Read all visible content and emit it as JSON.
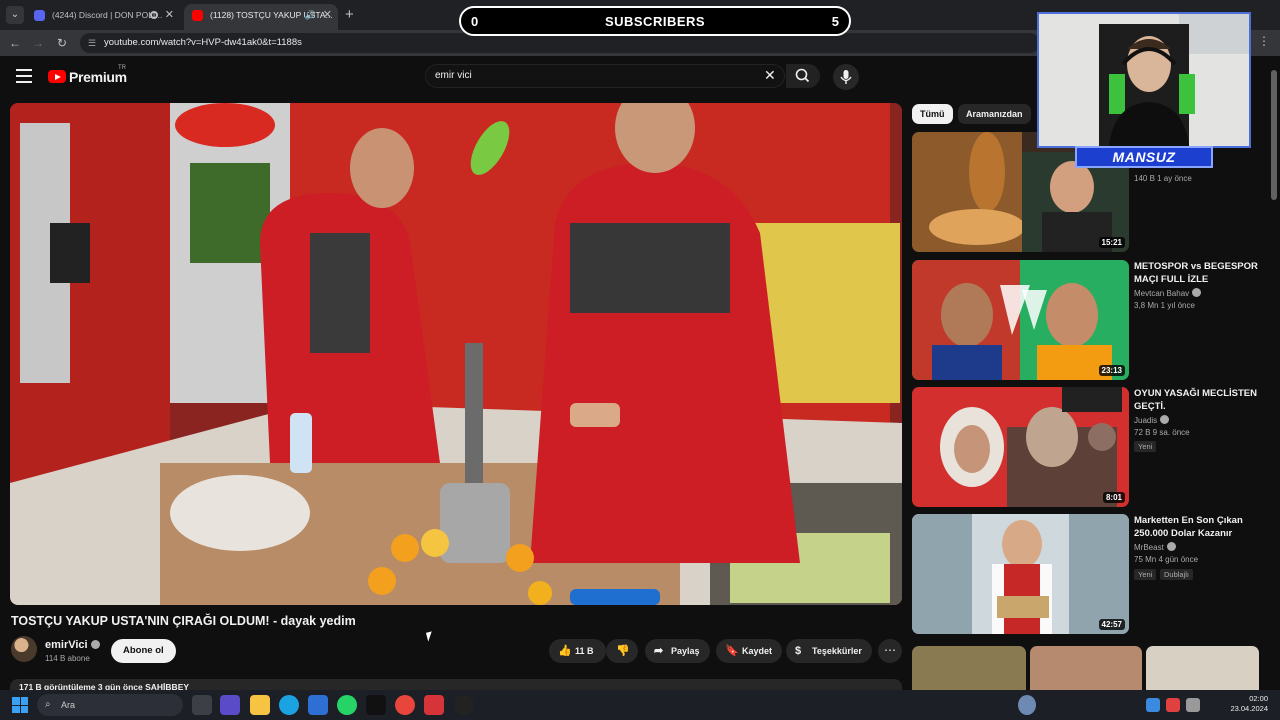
{
  "browser": {
    "tabs": [
      {
        "label": "(4244) Discord | DON POLI...",
        "active": false
      },
      {
        "label": "(1128) TOSTÇU YAKUP USTA...",
        "active": true
      }
    ],
    "url": "youtube.com/watch?v=HVP-dw41ak0&t=1188s"
  },
  "overlay": {
    "left_count": "0",
    "label": "SUBSCRIBERS",
    "right_count": "5",
    "streamer_name": "MANSUZ"
  },
  "youtube": {
    "logo_text": "Premium",
    "region": "TR",
    "search_query": "emir vici"
  },
  "video": {
    "title": "TOSTÇU YAKUP USTA'NIN ÇIRAĞI OLDUM! - dayak yedim",
    "channel": "emirVici",
    "subscribers": "114 B abone",
    "subscribe_label": "Abone ol",
    "likes": "11 B",
    "share_label": "Paylaş",
    "save_label": "Kaydet",
    "thanks_label": "Teşekkürler",
    "stats": "171 B görüntüleme  3 gün önce  SAHİBBEY"
  },
  "filters": {
    "all_label": "Tümü",
    "search_label": "Aramanızdan"
  },
  "recommendations": [
    {
      "title": "",
      "channel": "",
      "meta": "140 B  1 ay önce",
      "duration": "15:21",
      "badges": [],
      "colors": [
        "#b9752f",
        "#3b2a20"
      ]
    },
    {
      "title": "METOSPOR vs BEGESPOR MAÇI FULL İZLE",
      "channel": "Mevtcan Bahav",
      "meta": "3,8 Mn  1 yıl önce",
      "duration": "23:13",
      "badges": [],
      "colors": [
        "#c0392b",
        "#27ae60"
      ]
    },
    {
      "title": "OYUN YASAĞI MECLİSTEN GEÇTİ.",
      "channel": "Juadis",
      "meta": "72 B  9 sa. önce",
      "duration": "8:01",
      "badges": [
        "Yeni"
      ],
      "colors": [
        "#d32f2f",
        "#5d4037"
      ]
    },
    {
      "title": "Marketten En Son Çıkan 250.000 Dolar Kazanır",
      "channel": "MrBeast",
      "meta": "75 Mn  4 gün önce",
      "duration": "42:57",
      "badges": [
        "Yeni",
        "Dublajlı"
      ],
      "colors": [
        "#cfd8dc",
        "#c62828"
      ]
    }
  ],
  "taskbar": {
    "search_placeholder": "Ara",
    "time": "02:00",
    "date": "23.04.2024"
  }
}
